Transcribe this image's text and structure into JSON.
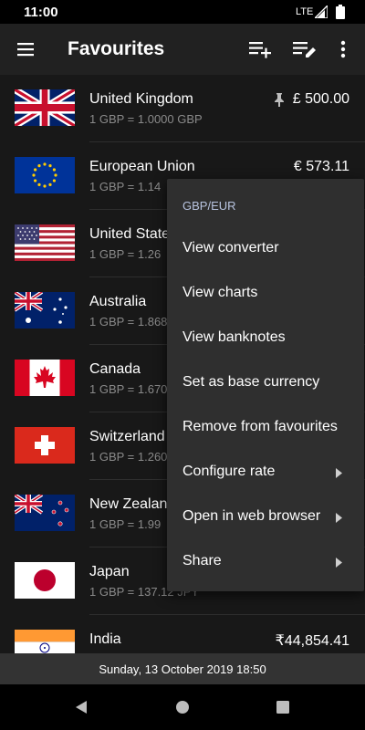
{
  "status_bar": {
    "time": "11:00",
    "network": "LTE"
  },
  "app_bar": {
    "title": "Favourites"
  },
  "currencies": [
    {
      "country": "United Kingdom",
      "rate": "1 GBP = 1.0000 GBP",
      "amount": "£ 500.00",
      "pinned": true,
      "flag": "gb-flag"
    },
    {
      "country": "European Union",
      "rate": "1 GBP = 1.14",
      "amount": "€ 573.11",
      "flag": "eu-flag"
    },
    {
      "country": "United States",
      "rate": "1 GBP = 1.26",
      "amount": "",
      "flag": "us-flag"
    },
    {
      "country": "Australia",
      "rate": "1 GBP = 1.868",
      "amount": "",
      "flag": "au-flag"
    },
    {
      "country": "Canada",
      "rate": "1 GBP = 1.670",
      "amount": "",
      "flag": "ca-flag"
    },
    {
      "country": "Switzerland",
      "rate": "1 GBP = 1.260",
      "amount": "",
      "flag": "ch-flag"
    },
    {
      "country": "New Zealand",
      "rate": "1 GBP = 1.99",
      "amount": "",
      "flag": "nz-flag"
    },
    {
      "country": "Japan",
      "rate": "1 GBP = 137.12 JPY",
      "amount": "",
      "flag": "jp-flag"
    },
    {
      "country": "India",
      "rate": "",
      "amount": "₹44,854.41",
      "flag": "in-flag"
    }
  ],
  "date_bar": {
    "text": "Sunday, 13 October 2019 18:50"
  },
  "context_menu": {
    "header": "GBP/EUR",
    "items": [
      {
        "label": "View converter",
        "submenu": false
      },
      {
        "label": "View charts",
        "submenu": false
      },
      {
        "label": "View banknotes",
        "submenu": false
      },
      {
        "label": "Set as base currency",
        "submenu": false
      },
      {
        "label": "Remove from favourites",
        "submenu": false
      },
      {
        "label": "Configure rate",
        "submenu": true
      },
      {
        "label": "Open in web browser",
        "submenu": true
      },
      {
        "label": "Share",
        "submenu": true
      }
    ]
  },
  "icons": {
    "app_bar": [
      "menu-icon",
      "add-list-icon",
      "edit-list-icon",
      "more-vert-icon"
    ],
    "navigation": [
      "back-icon",
      "home-icon",
      "recents-icon"
    ]
  },
  "colors": {
    "background": "#181818",
    "app_bar": "#212121",
    "menu": "#2f2f2f",
    "menu_header": "#b8c4e0",
    "secondary_text": "#8a8a8a",
    "date_bar": "#333333"
  }
}
